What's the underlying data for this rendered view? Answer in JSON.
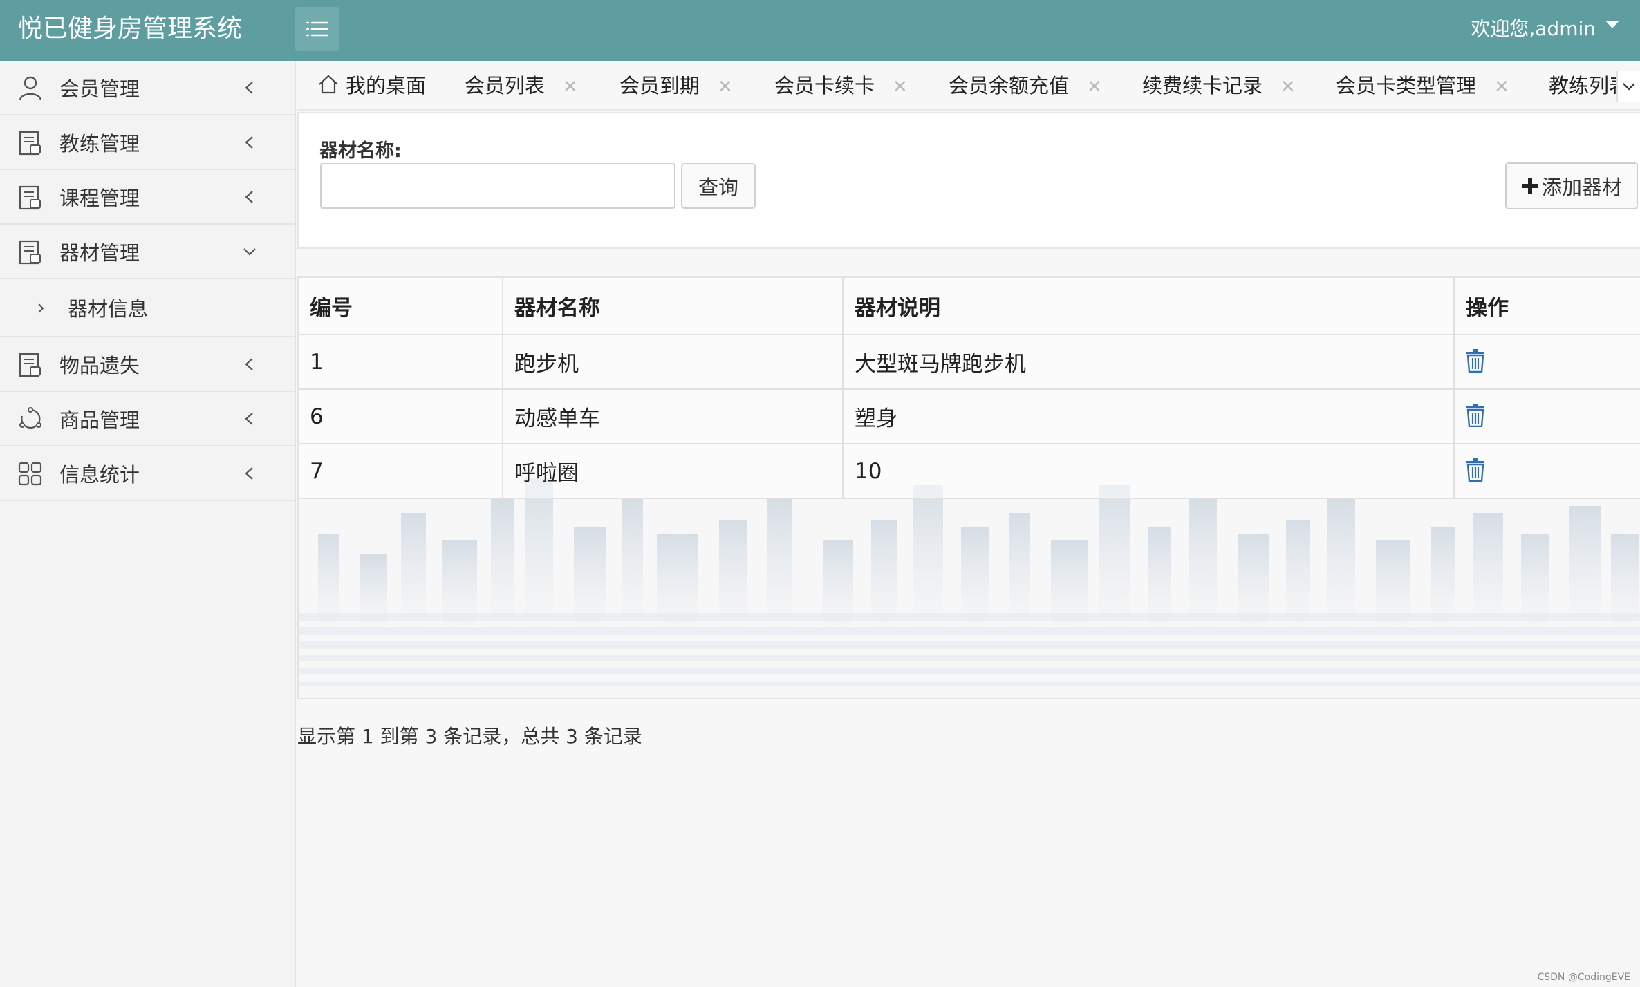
{
  "app": {
    "title": "悦已健身房管理系统",
    "welcome": "欢迎您,admin"
  },
  "sidebar": {
    "items": [
      {
        "label": "会员管理",
        "icon": "user-icon"
      },
      {
        "label": "教练管理",
        "icon": "document-icon"
      },
      {
        "label": "课程管理",
        "icon": "document-icon"
      },
      {
        "label": "器材管理",
        "icon": "document-icon",
        "expanded": true
      },
      {
        "label": "物品遗失",
        "icon": "document-icon"
      },
      {
        "label": "商品管理",
        "icon": "refresh-icon"
      },
      {
        "label": "信息统计",
        "icon": "grid-icon"
      }
    ],
    "sub_items": [
      {
        "label": "器材信息"
      }
    ]
  },
  "tabs": [
    {
      "label": "我的桌面",
      "closable": false
    },
    {
      "label": "会员列表",
      "closable": true
    },
    {
      "label": "会员到期",
      "closable": true
    },
    {
      "label": "会员卡续卡",
      "closable": true
    },
    {
      "label": "会员余额充值",
      "closable": true
    },
    {
      "label": "续费续卡记录",
      "closable": true
    },
    {
      "label": "会员卡类型管理",
      "closable": true
    },
    {
      "label": "教练列表",
      "closable": true
    }
  ],
  "search": {
    "label": "器材名称:",
    "value": "",
    "placeholder": "",
    "query_button": "查询",
    "add_button": "添加器材"
  },
  "table": {
    "headers": [
      "编号",
      "器材名称",
      "器材说明",
      "操作"
    ],
    "rows": [
      {
        "id": "1",
        "name": "跑步机",
        "desc": "大型斑马牌跑步机"
      },
      {
        "id": "6",
        "name": "动感单车",
        "desc": "塑身"
      },
      {
        "id": "7",
        "name": "呼啦圈",
        "desc": "10"
      }
    ]
  },
  "pager": {
    "text": "显示第 1 到第 3 条记录，总共 3 条记录"
  },
  "footer": {
    "credit": "CSDN @CodingEVE"
  },
  "colors": {
    "topbar": "#5f9ea0",
    "accent_blue": "#2f6fb3"
  }
}
